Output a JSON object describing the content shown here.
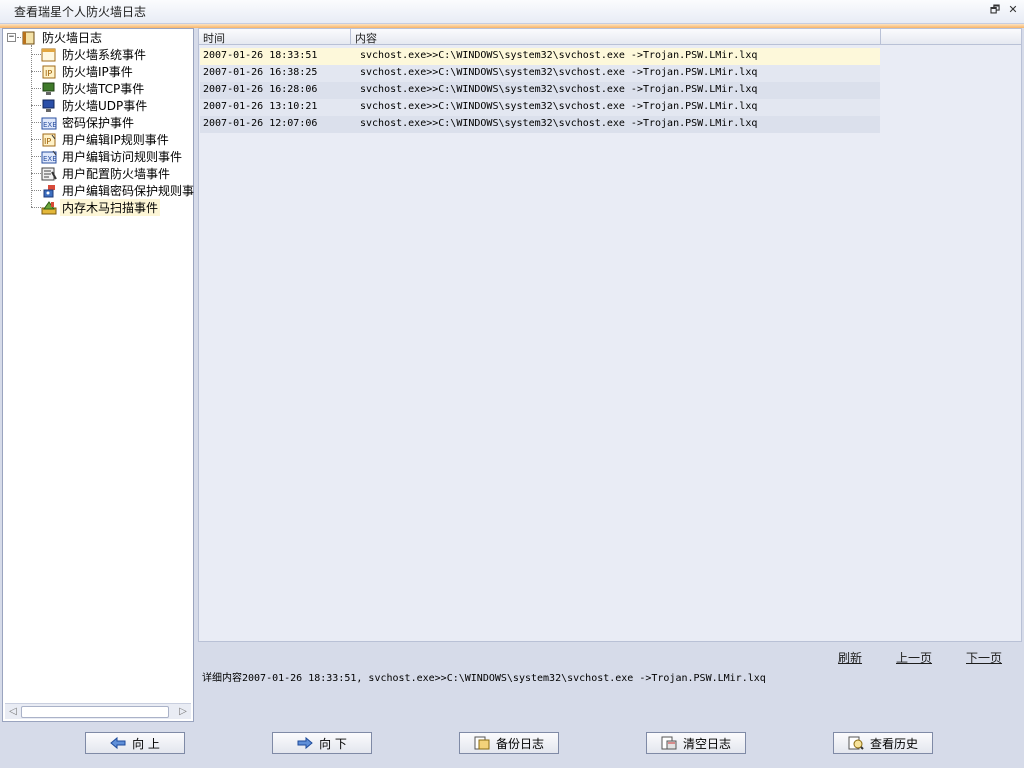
{
  "window": {
    "title": "查看瑞星个人防火墙日志",
    "restore_glyph": "🗗",
    "close_glyph": "✕"
  },
  "tree": {
    "root": {
      "label": "防火墙日志",
      "expander": "−",
      "icon": "book-icon"
    },
    "items": [
      {
        "label": "防火墙系统事件",
        "icon": "window-icon"
      },
      {
        "label": "防火墙IP事件",
        "icon": "ip-icon"
      },
      {
        "label": "防火墙TCP事件",
        "icon": "monitor-icon"
      },
      {
        "label": "防火墙UDP事件",
        "icon": "monitor-icon"
      },
      {
        "label": "密码保护事件",
        "icon": "exe-icon"
      },
      {
        "label": "用户编辑IP规则事件",
        "icon": "ip-edit-icon"
      },
      {
        "label": "用户编辑访问规则事件",
        "icon": "exe-edit-icon"
      },
      {
        "label": "用户配置防火墙事件",
        "icon": "config-icon"
      },
      {
        "label": "用户编辑密码保护规则事",
        "icon": "key-icon"
      },
      {
        "label": "内存木马扫描事件",
        "icon": "scan-icon",
        "selected": true
      }
    ]
  },
  "grid": {
    "columns": [
      "时间",
      "内容"
    ],
    "rows": [
      {
        "time": "2007-01-26 18:33:51",
        "content": "svchost.exe>>C:\\WINDOWS\\system32\\svchost.exe ->Trojan.PSW.LMir.lxq"
      },
      {
        "time": "2007-01-26 16:38:25",
        "content": "svchost.exe>>C:\\WINDOWS\\system32\\svchost.exe ->Trojan.PSW.LMir.lxq"
      },
      {
        "time": "2007-01-26 16:28:06",
        "content": "svchost.exe>>C:\\WINDOWS\\system32\\svchost.exe ->Trojan.PSW.LMir.lxq"
      },
      {
        "time": "2007-01-26 13:10:21",
        "content": "svchost.exe>>C:\\WINDOWS\\system32\\svchost.exe ->Trojan.PSW.LMir.lxq"
      },
      {
        "time": "2007-01-26 12:07:06",
        "content": "svchost.exe>>C:\\WINDOWS\\system32\\svchost.exe ->Trojan.PSW.LMir.lxq"
      }
    ]
  },
  "pager": {
    "refresh": "刷新",
    "prev": "上一页",
    "next": "下一页"
  },
  "detail": "详细内容2007-01-26 18:33:51, svchost.exe>>C:\\WINDOWS\\system32\\svchost.exe ->Trojan.PSW.LMir.lxq",
  "buttons": {
    "up": {
      "label": "向 上",
      "icon": "arrow-left-icon"
    },
    "down": {
      "label": "向 下",
      "icon": "arrow-right-icon"
    },
    "backup": {
      "label": "备份日志",
      "icon": "backup-icon"
    },
    "clear": {
      "label": "清空日志",
      "icon": "clear-icon"
    },
    "history": {
      "label": "查看历史",
      "icon": "history-icon"
    }
  },
  "colors": {
    "accent": "#f7b468",
    "selected_row": "#fdf8da",
    "panel": "#d6dbe9"
  }
}
